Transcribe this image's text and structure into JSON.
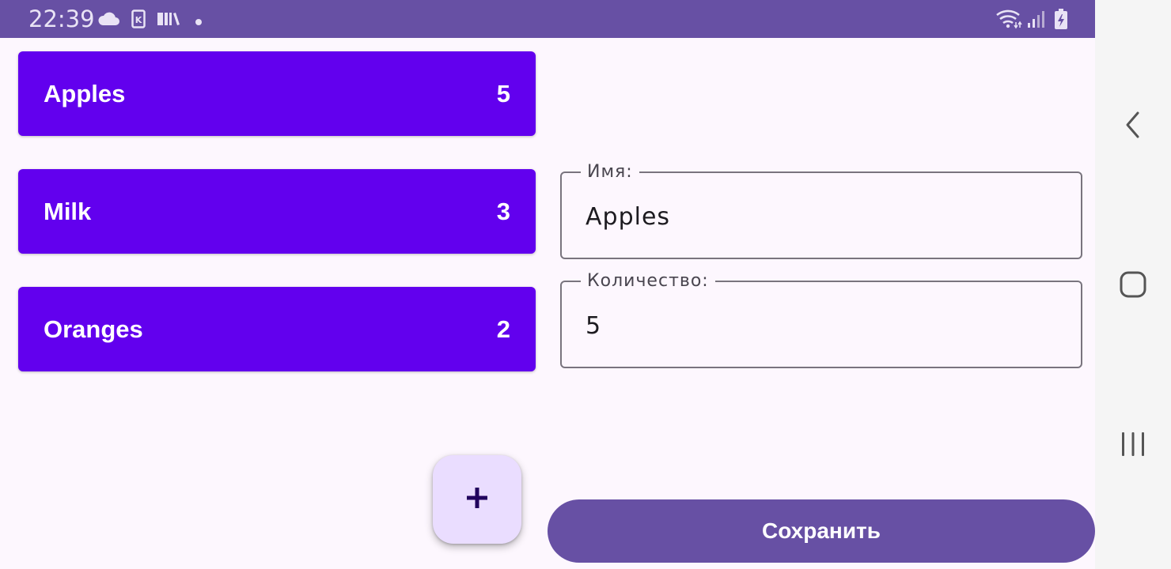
{
  "status_bar": {
    "time": "22:39",
    "icons": [
      "cloud-icon",
      "k-app-icon",
      "library-icon",
      "notification-dot-icon",
      "wifi-icon",
      "signal-icon",
      "battery-charging-icon"
    ]
  },
  "items": [
    {
      "name": "Apples",
      "qty": "5"
    },
    {
      "name": "Milk",
      "qty": "3"
    },
    {
      "name": "Oranges",
      "qty": "2"
    }
  ],
  "form": {
    "name_label": "Имя:",
    "name_value": "Apples",
    "qty_label": "Количество:",
    "qty_value": "5"
  },
  "fab": {
    "icon": "plus-icon"
  },
  "save_button": {
    "label": "Сохранить"
  },
  "nav_bar": {
    "icons": [
      "back-icon",
      "home-icon",
      "recents-icon"
    ]
  },
  "colors": {
    "status_bar": "#6750a4",
    "card": "#6200ee",
    "fab": "#eaddff",
    "save_button": "#6750a4",
    "background": "#fdf7fe"
  }
}
